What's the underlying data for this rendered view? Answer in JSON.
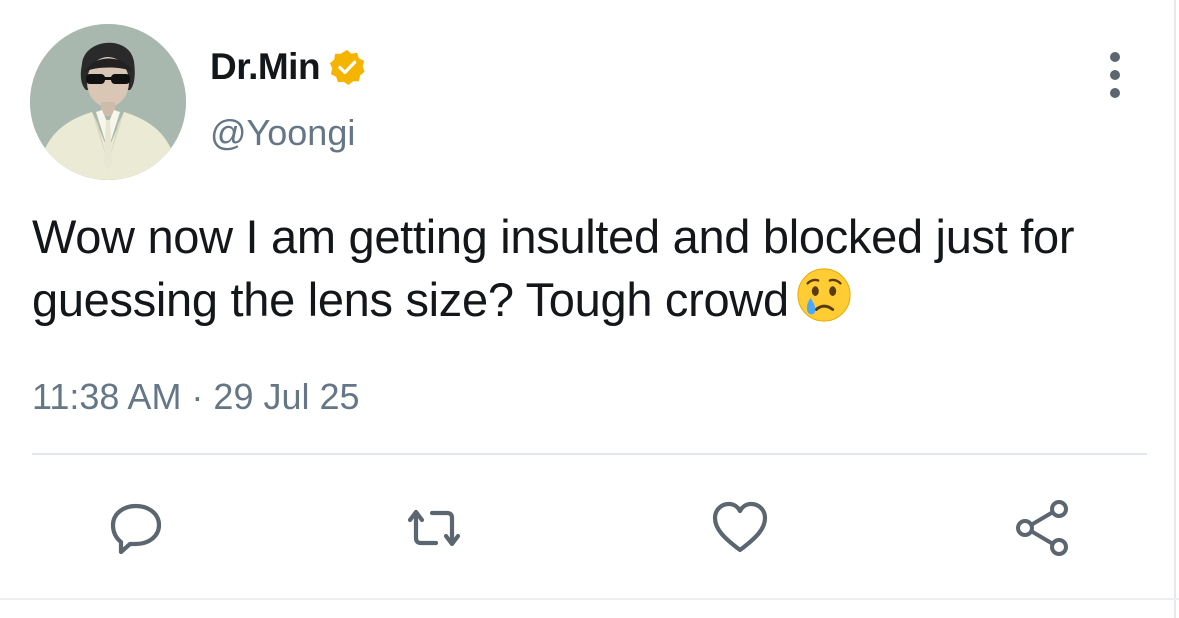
{
  "author": {
    "display_name": "Dr.Min",
    "handle": "@Yoongi",
    "verified": true,
    "verified_badge_color": "#f5b400"
  },
  "tweet": {
    "text": "Wow now I am getting insulted and blocked just for guessing the lens size? Tough crowd",
    "emoji": "crying-face",
    "timestamp": "11:38 AM · 29 Jul 25"
  },
  "actions": [
    {
      "name": "reply",
      "icon": "reply-icon"
    },
    {
      "name": "retweet",
      "icon": "retweet-icon"
    },
    {
      "name": "like",
      "icon": "heart-icon"
    },
    {
      "name": "share",
      "icon": "share-icon"
    }
  ],
  "colors": {
    "text_primary": "#14171a",
    "text_secondary": "#657786",
    "icon": "#5b6670",
    "divider": "#e1e8ed"
  }
}
